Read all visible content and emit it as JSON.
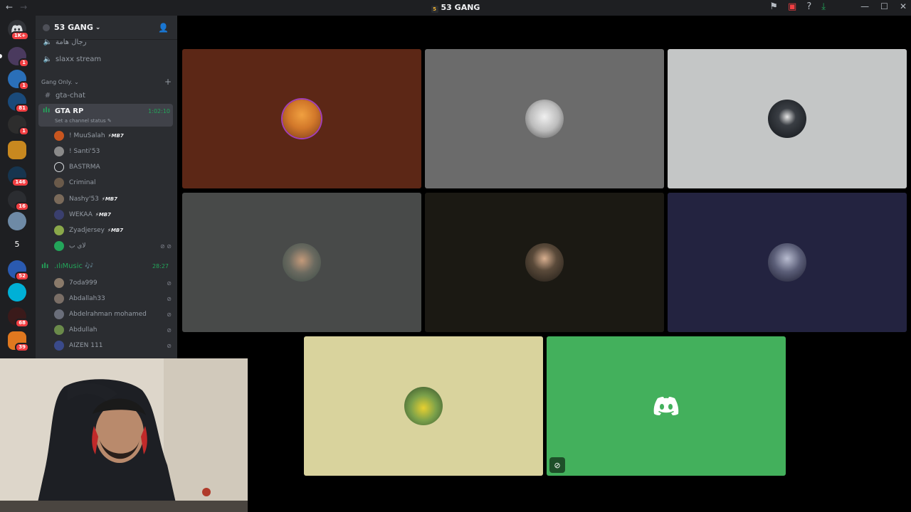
{
  "titlebar": {
    "title": "53 GANG",
    "back_icon": "←",
    "forward_icon": "→",
    "actions": [
      "flag-icon",
      "screen-share-icon",
      "help-icon",
      "download-icon"
    ],
    "window_controls": [
      "minimize",
      "maximize",
      "close"
    ]
  },
  "servers": [
    {
      "badge": "1K+",
      "icon": "discord-home"
    },
    {
      "badge": "1"
    },
    {
      "badge": "1"
    },
    {
      "badge": "81"
    },
    {
      "badge": "1"
    },
    {
      "badge": ""
    },
    {
      "badge": "146"
    },
    {
      "badge": "16"
    },
    {
      "badge": ""
    },
    {
      "label": "5"
    },
    {
      "badge": "52"
    },
    {
      "badge": ""
    },
    {
      "badge": "68"
    },
    {
      "badge": "39"
    }
  ],
  "guild": {
    "name": "53 GANG",
    "channels_top": [
      {
        "name": "رجال هامة",
        "type": "voice"
      },
      {
        "name": "slaxx stream",
        "type": "voice"
      }
    ],
    "category": "Gang Only.",
    "text_channel": "gta-chat",
    "active_voice": {
      "name": "GTA RP",
      "status": "Set a channel status",
      "timer": "1:02:10",
      "members": [
        {
          "name": "! MuuSalah",
          "tag": "MB7",
          "color": "#c8561f"
        },
        {
          "name": "! Santi'53",
          "tag": "",
          "color": "#8a8a8a"
        },
        {
          "name": "BASTRMA",
          "tag": "",
          "color": "#2b2d31"
        },
        {
          "name": "Criminal",
          "tag": "",
          "color": "#6a5a4a"
        },
        {
          "name": "Nashy'53",
          "tag": "MB7",
          "color": "#7a6a5a"
        },
        {
          "name": "WEKAA",
          "tag": "MB7",
          "color": "#3a3f6e"
        },
        {
          "name": "Zyadjersey",
          "tag": "MB7",
          "color": "#8aa84a"
        },
        {
          "name": "لاي ب",
          "tag": "",
          "color": "#23a55a"
        }
      ]
    },
    "music_channel": {
      "name": ".ılıMusic 🎶",
      "timer": "28:27",
      "members": [
        {
          "name": "7oda999",
          "color": "#8a7a6a"
        },
        {
          "name": "Abdallah33",
          "color": "#7a6e66"
        },
        {
          "name": "Abdelrahman mohamed",
          "color": "#6a6e7a"
        },
        {
          "name": "Abdullah",
          "color": "#6a8a4a"
        },
        {
          "name": "AIZEN 111",
          "color": "#3a4a8a"
        }
      ]
    }
  },
  "tiles": [
    {
      "bg": "#5c2716",
      "avatar": "#d2782a"
    },
    {
      "bg": "#6b6b6b",
      "avatar": "#cfcfcf"
    },
    {
      "bg": "#c4c6c6",
      "avatar": "#111418"
    },
    {
      "bg": "#484a49",
      "avatar": "#5b6a63"
    },
    {
      "bg": "#1b1913",
      "avatar": "#3a3126"
    },
    {
      "bg": "#232340",
      "avatar": "#5b5e78"
    },
    {
      "bg": "#d9d39d",
      "avatar": "#3f7a3b"
    },
    {
      "bg": "#43b05c",
      "avatar": "discord-logo"
    }
  ]
}
